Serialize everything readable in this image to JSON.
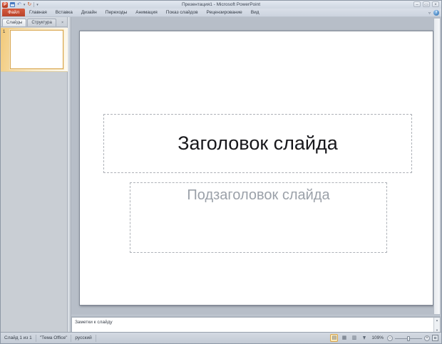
{
  "title_bar": {
    "title": "Презентация1 - Microsoft PowerPoint",
    "window_controls": {
      "minimize": "–",
      "restore": "▭",
      "close": "×"
    }
  },
  "quick_access": {
    "app_icon_letter": "P",
    "undo_glyph": "↶",
    "undo_dropdown_glyph": "▾",
    "redo_glyph": "↻",
    "customize_glyph": "▾"
  },
  "ribbon": {
    "file_tab": "Файл",
    "tabs": [
      "Главная",
      "Вставка",
      "Дизайн",
      "Переходы",
      "Анимация",
      "Показ слайдов",
      "Рецензирование",
      "Вид"
    ],
    "collapse_glyph": "▿",
    "help_glyph": "?"
  },
  "sidebar": {
    "tabs": [
      "Слайды",
      "Структура"
    ],
    "close_glyph": "×",
    "slide_number": "1"
  },
  "slide": {
    "title_placeholder": "Заголовок слайда",
    "subtitle_placeholder": "Подзаголовок слайда"
  },
  "notes": {
    "placeholder": "Заметки к слайду",
    "scroll_up_glyph": "▲",
    "scroll_down_glyph": "▼"
  },
  "status_bar": {
    "slide_indicator": "Слайд 1 из 1",
    "theme": "\"Тема Office\"",
    "language": "русский",
    "view_icons": {
      "normal": "▤",
      "sorter": "▦",
      "reading": "▥"
    },
    "zoom_level": "109%",
    "zoom_out_glyph": "–",
    "zoom_in_glyph": "+"
  }
}
